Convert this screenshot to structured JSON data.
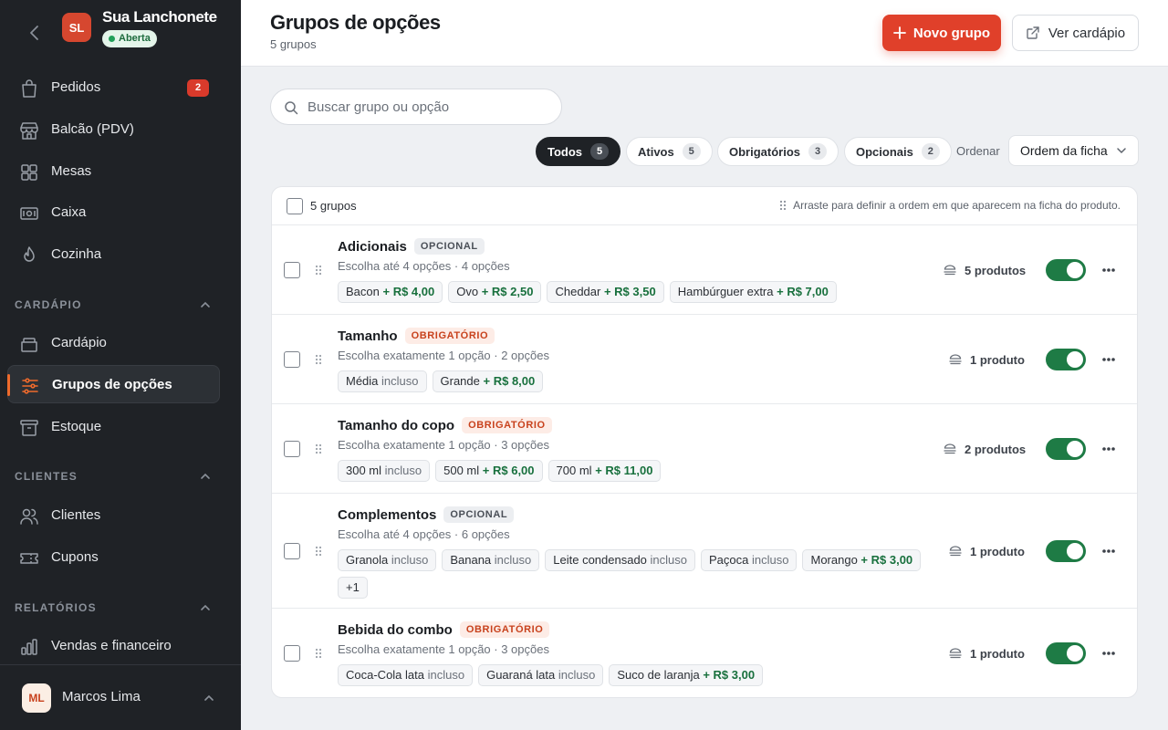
{
  "sidebar": {
    "store": {
      "initials": "SL",
      "name": "Sua Lanchonete",
      "status": "Aberta"
    },
    "main_items": [
      {
        "label": "Pedidos",
        "icon": "shopping-bag-icon",
        "badge": "2"
      },
      {
        "label": "Balcão (PDV)",
        "icon": "store-icon"
      },
      {
        "label": "Mesas",
        "icon": "grid-icon"
      },
      {
        "label": "Caixa",
        "icon": "cash-icon"
      },
      {
        "label": "Cozinha",
        "icon": "flame-icon"
      }
    ],
    "sections": [
      {
        "title": "CARDÁPIO",
        "items": [
          {
            "label": "Cardápio",
            "icon": "menu-book-icon"
          },
          {
            "label": "Grupos de opções",
            "icon": "sliders-icon",
            "active": true
          },
          {
            "label": "Estoque",
            "icon": "archive-box-icon"
          }
        ]
      },
      {
        "title": "CLIENTES",
        "items": [
          {
            "label": "Clientes",
            "icon": "users-icon"
          },
          {
            "label": "Cupons",
            "icon": "ticket-icon"
          }
        ]
      },
      {
        "title": "RELATÓRIOS",
        "items": [
          {
            "label": "Vendas e financeiro",
            "icon": "bar-chart-icon"
          }
        ]
      }
    ],
    "user": {
      "initials": "ML",
      "name": "Marcos Lima"
    }
  },
  "header": {
    "title": "Grupos de opções",
    "subtitle": "5 grupos",
    "new_button": "Novo grupo",
    "view_button": "Ver cardápio"
  },
  "toolbar": {
    "search_placeholder": "Buscar grupo ou opção",
    "filters": [
      {
        "label": "Todos",
        "count": "5",
        "active": true
      },
      {
        "label": "Ativos",
        "count": "5"
      },
      {
        "label": "Obrigatórios",
        "count": "3"
      },
      {
        "label": "Opcionais",
        "count": "2"
      }
    ],
    "order_label": "Ordenar",
    "order_value": "Ordem da ficha"
  },
  "list": {
    "count_label": "5 grupos",
    "hint": "Arraste para definir a ordem em que aparecem na ficha do produto.",
    "groups": [
      {
        "name": "Adicionais",
        "tag": "OPCIONAL",
        "tag_type": "opt",
        "desc": "Escolha até 4 opções · 4 opções",
        "options": [
          [
            "Bacon",
            "+ R$ 4,00"
          ],
          [
            "Ovo",
            "+ R$ 2,50"
          ],
          [
            "Cheddar",
            "+ R$ 3,50"
          ],
          [
            "Hambúrguer extra",
            "+ R$ 7,00"
          ]
        ],
        "products": "5 produtos",
        "enabled": true
      },
      {
        "name": "Tamanho",
        "tag": "OBRIGATÓRIO",
        "tag_type": "req",
        "desc": "Escolha exatamente 1 opção · 2 opções",
        "options": [
          [
            "Média",
            "incluso"
          ],
          [
            "Grande",
            "+ R$ 8,00"
          ]
        ],
        "products": "1 produto",
        "enabled": true
      },
      {
        "name": "Tamanho do copo",
        "tag": "OBRIGATÓRIO",
        "tag_type": "req",
        "desc": "Escolha exatamente 1 opção · 3 opções",
        "options": [
          [
            "300 ml",
            "incluso"
          ],
          [
            "500 ml",
            "+ R$ 6,00"
          ],
          [
            "700 ml",
            "+ R$ 11,00"
          ]
        ],
        "products": "2 produtos",
        "enabled": true
      },
      {
        "name": "Complementos",
        "tag": "OPCIONAL",
        "tag_type": "opt",
        "desc": "Escolha até 4 opções · 6 opções",
        "options": [
          [
            "Granola",
            "incluso"
          ],
          [
            "Banana",
            "incluso"
          ],
          [
            "Leite condensado",
            "incluso"
          ],
          [
            "Paçoca",
            "incluso"
          ],
          [
            "Morango",
            "+ R$ 3,00"
          ]
        ],
        "more": "+1",
        "products": "1 produto",
        "enabled": true
      },
      {
        "name": "Bebida do combo",
        "tag": "OBRIGATÓRIO",
        "tag_type": "req",
        "desc": "Escolha exatamente 1 opção · 3 opções",
        "options": [
          [
            "Coca-Cola lata",
            "incluso"
          ],
          [
            "Guaraná lata",
            "incluso"
          ],
          [
            "Suco de laranja",
            "+ R$ 3,00"
          ]
        ],
        "products": "1 produto",
        "enabled": true
      }
    ]
  },
  "colors": {
    "accent": "#e0402a",
    "active_nav": "#ee6a2c",
    "toggle_on": "#1e7b45",
    "price": "#18703d",
    "sidebar_bg": "#1f2226"
  }
}
